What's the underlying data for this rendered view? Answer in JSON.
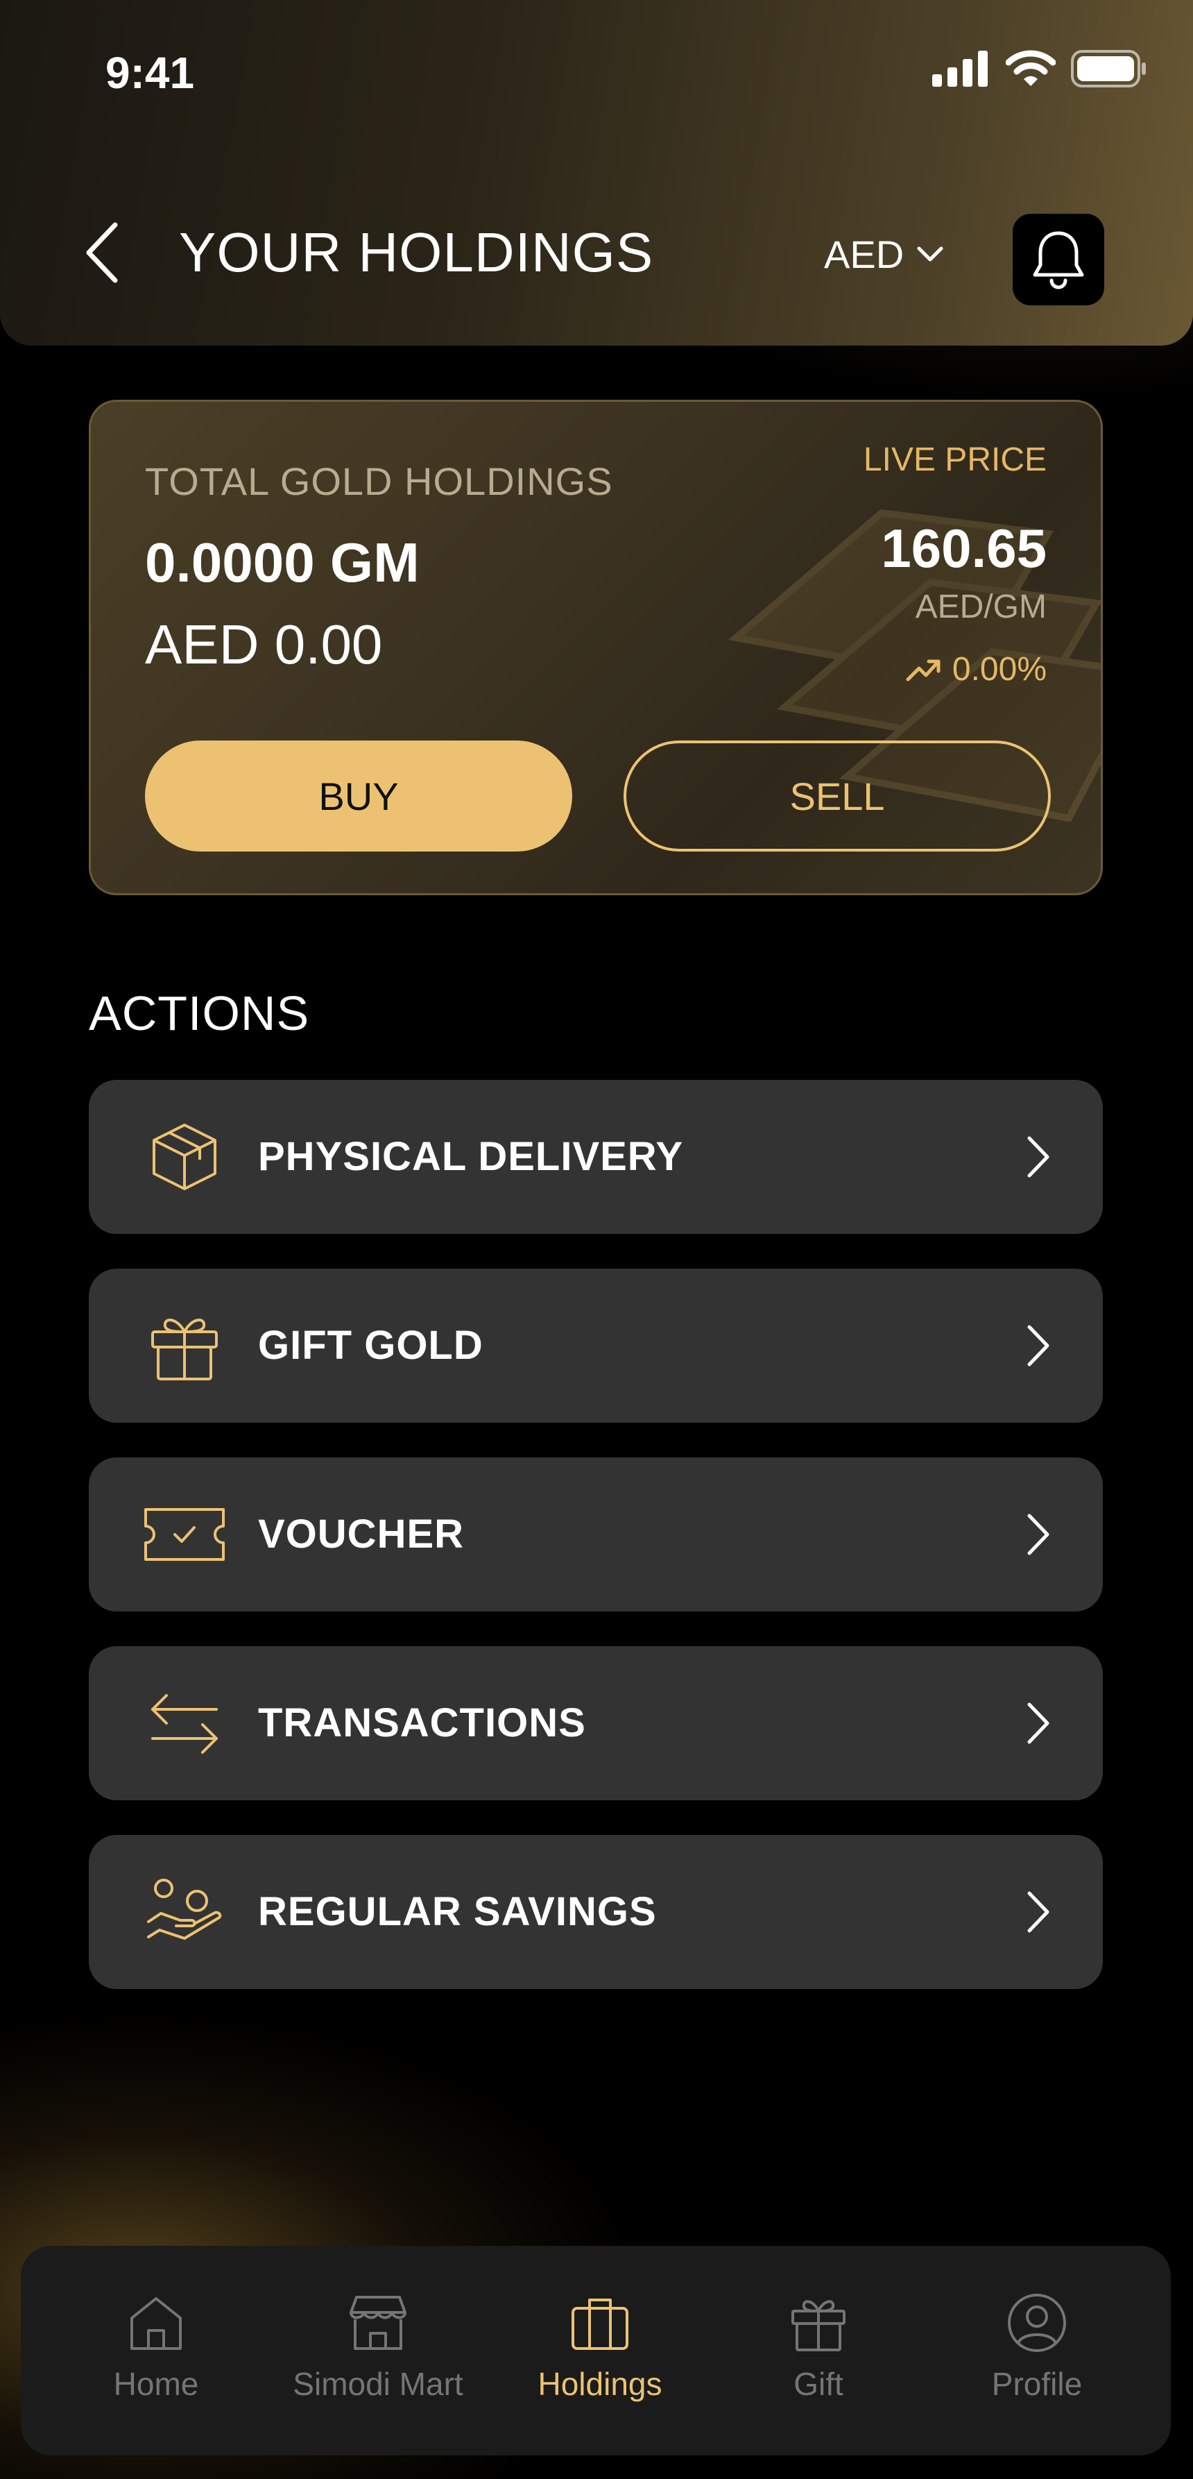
{
  "status_bar": {
    "time": "9:41"
  },
  "header": {
    "title": "YOUR HOLDINGS",
    "currency": "AED"
  },
  "holdings": {
    "total_label": "TOTAL GOLD HOLDINGS",
    "grams": "0.0000 GM",
    "aed_value": "AED 0.00",
    "live_price_label": "LIVE PRICE",
    "price": "160.65",
    "unit": "AED/GM",
    "change": "0.00%",
    "buy_label": "BUY",
    "sell_label": "SELL"
  },
  "actions": {
    "title": "ACTIONS",
    "items": [
      {
        "label": "PHYSICAL DELIVERY",
        "icon": "box-icon"
      },
      {
        "label": "GIFT GOLD",
        "icon": "gift-icon"
      },
      {
        "label": "VOUCHER",
        "icon": "voucher-icon"
      },
      {
        "label": "TRANSACTIONS",
        "icon": "transfer-arrows-icon"
      },
      {
        "label": "REGULAR SAVINGS",
        "icon": "savings-hand-icon"
      }
    ]
  },
  "bottom_nav": {
    "items": [
      {
        "label": "Home",
        "icon": "home-icon"
      },
      {
        "label": "Simodi Mart",
        "icon": "store-icon"
      },
      {
        "label": "Holdings",
        "icon": "briefcase-icon"
      },
      {
        "label": "Gift",
        "icon": "gift-icon"
      },
      {
        "label": "Profile",
        "icon": "user-icon"
      }
    ],
    "active": "Holdings"
  },
  "colors": {
    "accent": "#ECC272",
    "card_row": "#333334",
    "inactive_nav": "#757575"
  }
}
